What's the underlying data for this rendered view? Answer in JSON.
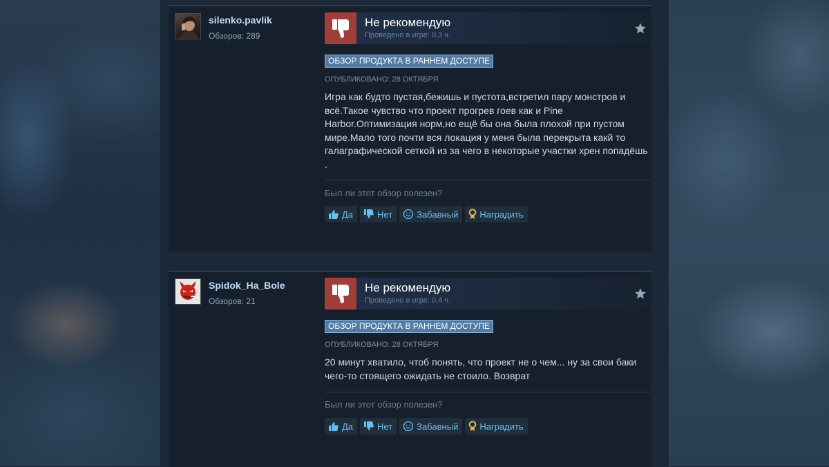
{
  "colors": {
    "page_bg": "#1b2838",
    "card_bg": "#16202d",
    "thumb_down": "#a33d38",
    "early_access_badge": "#4f7ba6",
    "link_blue": "#66c0f4",
    "award_gold": "#e8b84a"
  },
  "reviews": [
    {
      "author": "silenko.pavlik",
      "review_count": "Обзоров: 289",
      "verdict": "Не рекомендую",
      "playtime": "Проведено в игре: 0,3 ч.",
      "badge": "ОБЗОР ПРОДУКТА В РАННЕМ ДОСТУПЕ",
      "posted": "ОПУБЛИКОВАНО: 28 ОКТЯБРЯ",
      "text": "Игра как будто пустая,бежишь и пустота,встретил пару монстров и всё.Такое чувство что проект прогрев гоев как и Pine Harbor.Оптимизация норм,но ещё бы она была плохой при пустом мире.Мало того почти вся локация у меня была перекрыта какй то галаграфической сеткой из за чего в некоторые участки хрен попадёшь .",
      "helpful_question": "Был ли этот обзор полезен?",
      "buttons": {
        "yes": "Да",
        "no": "Нет",
        "funny": "Забавный",
        "award": "Наградить"
      }
    },
    {
      "author": "Spidok_Ha_Bole",
      "review_count": "Обзоров: 21",
      "verdict": "Не рекомендую",
      "playtime": "Проведено в игре: 0,4 ч.",
      "badge": "ОБЗОР ПРОДУКТА В РАННЕМ ДОСТУПЕ",
      "posted": "ОПУБЛИКОВАНО: 28 ОКТЯБРЯ",
      "text": "20 минут хватило, чтоб понять, что проект не о чем... ну за свои баки чего-то стоящего ожидать не стоило. Возврат",
      "helpful_question": "Был ли этот обзор полезен?",
      "buttons": {
        "yes": "Да",
        "no": "Нет",
        "funny": "Забавный",
        "award": "Наградить"
      }
    }
  ]
}
